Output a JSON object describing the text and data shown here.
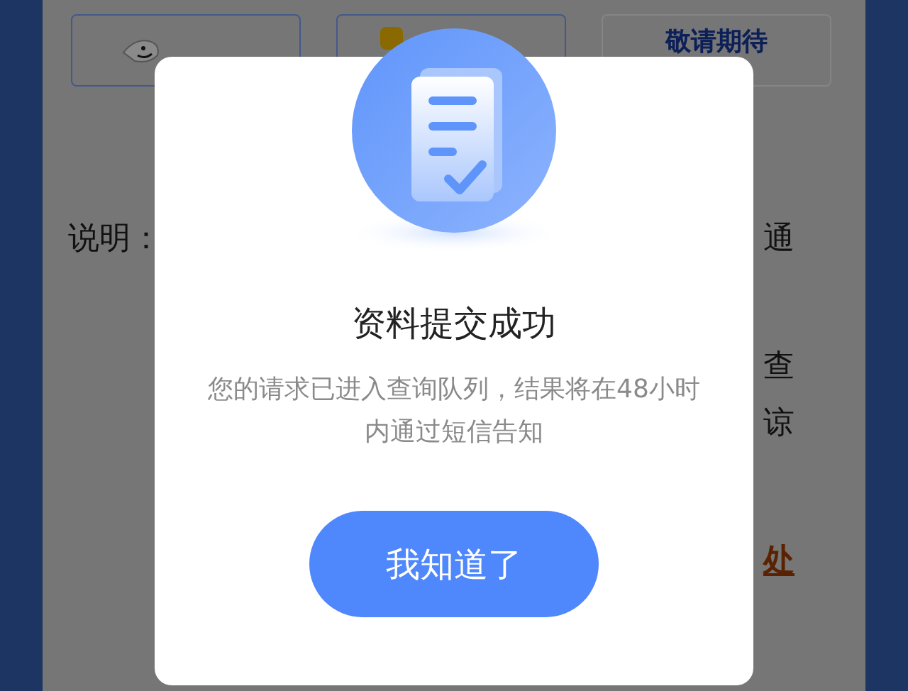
{
  "tiles": [
    {
      "kind": "jd"
    },
    {
      "kind": "app"
    },
    {
      "kind": "text",
      "label": "敬请期待"
    }
  ],
  "notes": [
    {
      "kind": "plain",
      "left": "说明：",
      "right": "通"
    },
    {
      "kind": "plain",
      "right": "查"
    },
    {
      "kind": "plain",
      "right": "谅"
    },
    {
      "kind": "link",
      "right": "处"
    }
  ],
  "dialog": {
    "title": "资料提交成功",
    "message": "您的请求已进入查询队列，结果将在48小时内通过短信告知",
    "button": "我知道了"
  }
}
